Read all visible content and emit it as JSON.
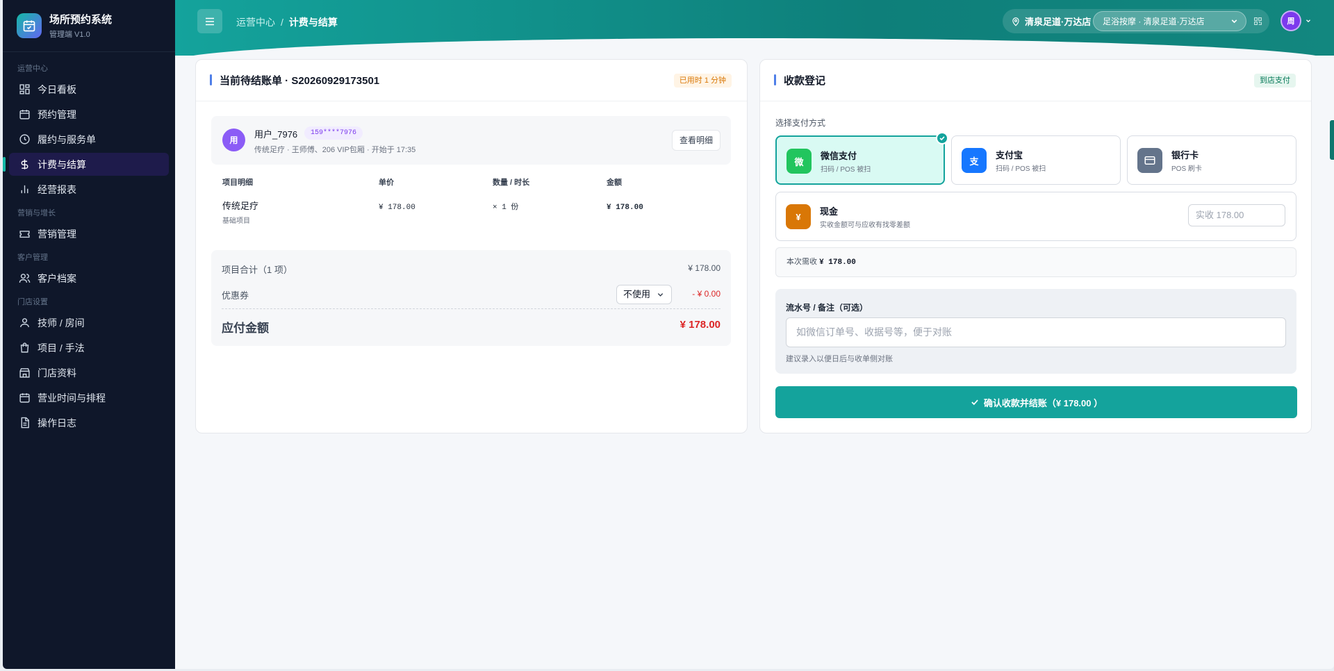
{
  "app": {
    "title": "场所预约系统",
    "subtitle": "管理端 V1.0"
  },
  "sidebar": {
    "groups": [
      {
        "label": "运营中心"
      },
      {
        "label": "营销与增长"
      },
      {
        "label": "客户管理"
      },
      {
        "label": "门店设置"
      }
    ],
    "items": [
      {
        "label": "今日看板",
        "icon": "dashboard-icon"
      },
      {
        "label": "预约管理",
        "icon": "calendar-icon"
      },
      {
        "label": "履约与服务单",
        "icon": "clock-icon"
      },
      {
        "label": "计费与结算",
        "icon": "dollar-icon",
        "active": true
      },
      {
        "label": "经营报表",
        "icon": "bar-chart-icon"
      },
      {
        "label": "营销管理",
        "icon": "ticket-icon"
      },
      {
        "label": "客户档案",
        "icon": "users-icon"
      },
      {
        "label": "技师 / 房间",
        "icon": "user-icon"
      },
      {
        "label": "项目 / 手法",
        "icon": "bag-icon"
      },
      {
        "label": "门店资料",
        "icon": "store-icon"
      },
      {
        "label": "营业时间与排程",
        "icon": "calendar-icon"
      },
      {
        "label": "操作日志",
        "icon": "file-icon"
      }
    ]
  },
  "header": {
    "breadcrumb": [
      "运营中心",
      "/",
      "计费与结算"
    ],
    "store_name": "清泉足道·万达店",
    "store_select": "足浴按摩 · 清泉足道·万达店",
    "avatar": "周"
  },
  "bill": {
    "title": "当前待结账单 · S20260929173501",
    "elapsed": "已用时 1 分钟",
    "customer": {
      "avatar": "用",
      "name": "用户_7976",
      "phone": "159****7976",
      "desc": "传统足疗 · 王师傅、206 VIP包厢 · 开始于 17:35"
    },
    "detail_button": "查看明细",
    "columns": [
      "项目明细",
      "单价",
      "数量 / 时长",
      "金额"
    ],
    "rows": [
      {
        "name": "传统足疗",
        "sub": "基础项目",
        "price": "¥ 178.00",
        "qty": "× 1 份",
        "amount": "¥ 178.00"
      }
    ],
    "subtotal_label": "项目合计（1 项）",
    "subtotal": "¥ 178.00",
    "coupon_label": "优惠券",
    "coupon_select": "不使用",
    "coupon_discount": "- ¥ 0.00",
    "payable_label": "应付金额",
    "payable": "¥ 178.00"
  },
  "payment": {
    "title": "收款登记",
    "badge": "到店支付",
    "method_label": "选择支付方式",
    "methods": [
      {
        "name": "微信支付",
        "sub": "扫码 / POS 被扫",
        "icon": "微",
        "color": "#22c55e",
        "selected": true
      },
      {
        "name": "支付宝",
        "sub": "扫码 / POS 被扫",
        "icon": "支",
        "color": "#1677ff"
      },
      {
        "name": "银行卡",
        "sub": "POS 刷卡",
        "icon": "card-icon",
        "color": "#64748b"
      },
      {
        "name": "现金",
        "sub": "实收金额可与应收有找零差额",
        "icon": "¥",
        "color": "#d97706"
      }
    ],
    "cash_placeholder": "实收 178.00",
    "due_label": "本次需收",
    "due_value": "¥ 178.00",
    "note_label": "流水号 / 备注（可选）",
    "note_placeholder": "如微信订单号、收据号等，便于对账",
    "note_hint": "建议录入以便日后与收单侧对账",
    "confirm": "确认收款并结账（¥ 178.00 ）"
  }
}
